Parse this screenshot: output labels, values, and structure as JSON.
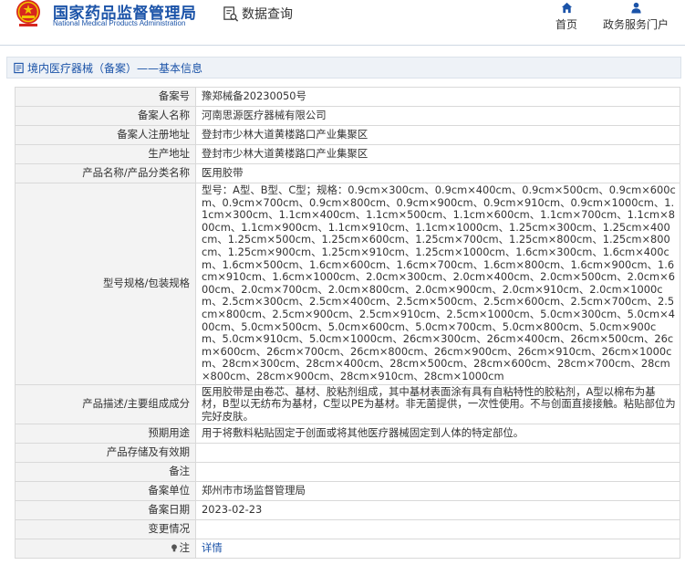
{
  "header": {
    "site_name": "国家药品监督管理局",
    "site_name_en": "National Medical Products Administration",
    "page_label": "数据查询",
    "nav": [
      {
        "label": "首页",
        "icon": "home-icon"
      },
      {
        "label": "政务服务门户",
        "icon": "user-icon"
      }
    ]
  },
  "breadcrumb": {
    "text": "境内医疗器械（备案）——基本信息"
  },
  "record": {
    "rows": [
      {
        "label": "备案号",
        "value": "豫郑械备20230050号"
      },
      {
        "label": "备案人名称",
        "value": "河南思源医疗器械有限公司"
      },
      {
        "label": "备案人注册地址",
        "value": "登封市少林大道黄楼路口产业集聚区"
      },
      {
        "label": "生产地址",
        "value": "登封市少林大道黄楼路口产业集聚区"
      },
      {
        "label": "产品名称/产品分类名称",
        "value": "医用胶带"
      },
      {
        "label": "型号规格/包装规格",
        "value": "型号：A型、B型、C型；规格：0.9cm×300cm、0.9cm×400cm、0.9cm×500cm、0.9cm×600cm、0.9cm×700cm、0.9cm×800cm、0.9cm×900cm、0.9cm×910cm、0.9cm×1000cm、1.1cm×300cm、1.1cm×400cm、1.1cm×500cm、1.1cm×600cm、1.1cm×700cm、1.1cm×800cm、1.1cm×900cm、1.1cm×910cm、1.1cm×1000cm、1.25cm×300cm、1.25cm×400cm、1.25cm×500cm、1.25cm×600cm、1.25cm×700cm、1.25cm×800cm、1.25cm×800cm、1.25cm×900cm、1.25cm×910cm、1.25cm×1000cm、1.6cm×300cm、1.6cm×400cm、1.6cm×500cm、1.6cm×600cm、1.6cm×700cm、1.6cm×800cm、1.6cm×900cm、1.6cm×910cm、1.6cm×1000cm、2.0cm×300cm、2.0cm×400cm、2.0cm×500cm、2.0cm×600cm、2.0cm×700cm、2.0cm×800cm、2.0cm×900cm、2.0cm×910cm、2.0cm×1000cm、2.5cm×300cm、2.5cm×400cm、2.5cm×500cm、2.5cm×600cm、2.5cm×700cm、2.5cm×800cm、2.5cm×900cm、2.5cm×910cm、2.5cm×1000cm、5.0cm×300cm、5.0cm×400cm、5.0cm×500cm、5.0cm×600cm、5.0cm×700cm、5.0cm×800cm、5.0cm×900cm、5.0cm×910cm、5.0cm×1000cm、26cm×300cm、26cm×400cm、26cm×500cm、26cm×600cm、26cm×700cm、26cm×800cm、26cm×900cm、26cm×910cm、26cm×1000cm、28cm×300cm、28cm×400cm、28cm×500cm、28cm×600cm、28cm×700cm、28cm×800cm、28cm×900cm、28cm×910cm、28cm×1000cm"
      },
      {
        "label": "产品描述/主要组成成分",
        "value": "医用胶带是由卷芯、基材、胶粘剂组成，其中基材表面涂有具有自粘特性的胶粘剂，A型以棉布为基材，B型以无纺布为基材，C型以PE为基材。非无菌提供，一次性使用。不与创面直接接触。粘贴部位为完好皮肤。"
      },
      {
        "label": "预期用途",
        "value": "用于将敷料粘贴固定于创面或将其他医疗器械固定到人体的特定部位。"
      },
      {
        "label": "产品存储及有效期",
        "value": ""
      },
      {
        "label": "备注",
        "value": ""
      },
      {
        "label": "备案单位",
        "value": "郑州市市场监督管理局"
      },
      {
        "label": "备案日期",
        "value": "2023-02-23"
      },
      {
        "label": "变更情况",
        "value": ""
      },
      {
        "label": "注",
        "value": "详情",
        "icon": "lightbulb-icon"
      }
    ]
  },
  "colors": {
    "brand_blue": "#1b53a8",
    "emblem_red": "#d7261e",
    "emblem_gold": "#f2c200",
    "label_bg": "#f3f3f3",
    "border": "#d9d9d9"
  }
}
